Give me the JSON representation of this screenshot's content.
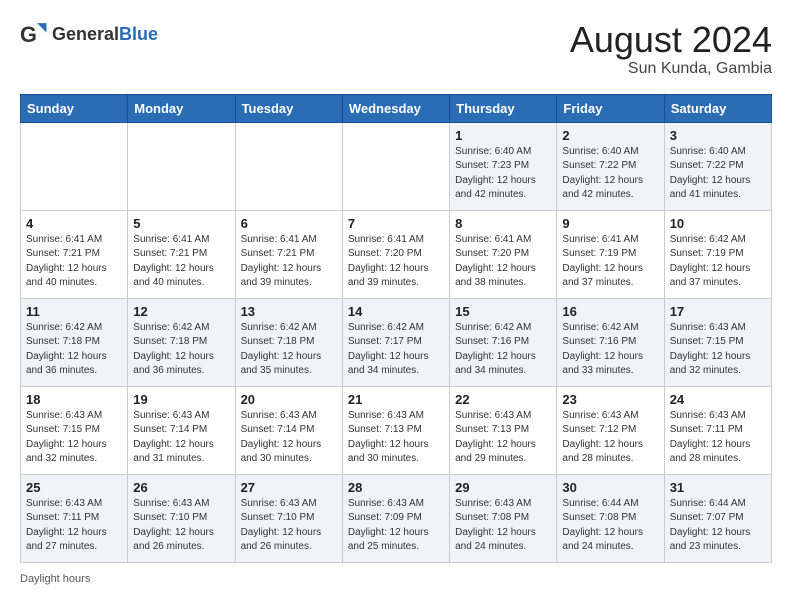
{
  "header": {
    "logo_general": "General",
    "logo_blue": "Blue",
    "month_year": "August 2024",
    "location": "Sun Kunda, Gambia"
  },
  "footer": {
    "daylight_label": "Daylight hours"
  },
  "weekdays": [
    "Sunday",
    "Monday",
    "Tuesday",
    "Wednesday",
    "Thursday",
    "Friday",
    "Saturday"
  ],
  "weeks": [
    [
      {
        "day": "",
        "info": ""
      },
      {
        "day": "",
        "info": ""
      },
      {
        "day": "",
        "info": ""
      },
      {
        "day": "",
        "info": ""
      },
      {
        "day": "1",
        "info": "Sunrise: 6:40 AM\nSunset: 7:23 PM\nDaylight: 12 hours\nand 42 minutes."
      },
      {
        "day": "2",
        "info": "Sunrise: 6:40 AM\nSunset: 7:22 PM\nDaylight: 12 hours\nand 42 minutes."
      },
      {
        "day": "3",
        "info": "Sunrise: 6:40 AM\nSunset: 7:22 PM\nDaylight: 12 hours\nand 41 minutes."
      }
    ],
    [
      {
        "day": "4",
        "info": "Sunrise: 6:41 AM\nSunset: 7:21 PM\nDaylight: 12 hours\nand 40 minutes."
      },
      {
        "day": "5",
        "info": "Sunrise: 6:41 AM\nSunset: 7:21 PM\nDaylight: 12 hours\nand 40 minutes."
      },
      {
        "day": "6",
        "info": "Sunrise: 6:41 AM\nSunset: 7:21 PM\nDaylight: 12 hours\nand 39 minutes."
      },
      {
        "day": "7",
        "info": "Sunrise: 6:41 AM\nSunset: 7:20 PM\nDaylight: 12 hours\nand 39 minutes."
      },
      {
        "day": "8",
        "info": "Sunrise: 6:41 AM\nSunset: 7:20 PM\nDaylight: 12 hours\nand 38 minutes."
      },
      {
        "day": "9",
        "info": "Sunrise: 6:41 AM\nSunset: 7:19 PM\nDaylight: 12 hours\nand 37 minutes."
      },
      {
        "day": "10",
        "info": "Sunrise: 6:42 AM\nSunset: 7:19 PM\nDaylight: 12 hours\nand 37 minutes."
      }
    ],
    [
      {
        "day": "11",
        "info": "Sunrise: 6:42 AM\nSunset: 7:18 PM\nDaylight: 12 hours\nand 36 minutes."
      },
      {
        "day": "12",
        "info": "Sunrise: 6:42 AM\nSunset: 7:18 PM\nDaylight: 12 hours\nand 36 minutes."
      },
      {
        "day": "13",
        "info": "Sunrise: 6:42 AM\nSunset: 7:18 PM\nDaylight: 12 hours\nand 35 minutes."
      },
      {
        "day": "14",
        "info": "Sunrise: 6:42 AM\nSunset: 7:17 PM\nDaylight: 12 hours\nand 34 minutes."
      },
      {
        "day": "15",
        "info": "Sunrise: 6:42 AM\nSunset: 7:16 PM\nDaylight: 12 hours\nand 34 minutes."
      },
      {
        "day": "16",
        "info": "Sunrise: 6:42 AM\nSunset: 7:16 PM\nDaylight: 12 hours\nand 33 minutes."
      },
      {
        "day": "17",
        "info": "Sunrise: 6:43 AM\nSunset: 7:15 PM\nDaylight: 12 hours\nand 32 minutes."
      }
    ],
    [
      {
        "day": "18",
        "info": "Sunrise: 6:43 AM\nSunset: 7:15 PM\nDaylight: 12 hours\nand 32 minutes."
      },
      {
        "day": "19",
        "info": "Sunrise: 6:43 AM\nSunset: 7:14 PM\nDaylight: 12 hours\nand 31 minutes."
      },
      {
        "day": "20",
        "info": "Sunrise: 6:43 AM\nSunset: 7:14 PM\nDaylight: 12 hours\nand 30 minutes."
      },
      {
        "day": "21",
        "info": "Sunrise: 6:43 AM\nSunset: 7:13 PM\nDaylight: 12 hours\nand 30 minutes."
      },
      {
        "day": "22",
        "info": "Sunrise: 6:43 AM\nSunset: 7:13 PM\nDaylight: 12 hours\nand 29 minutes."
      },
      {
        "day": "23",
        "info": "Sunrise: 6:43 AM\nSunset: 7:12 PM\nDaylight: 12 hours\nand 28 minutes."
      },
      {
        "day": "24",
        "info": "Sunrise: 6:43 AM\nSunset: 7:11 PM\nDaylight: 12 hours\nand 28 minutes."
      }
    ],
    [
      {
        "day": "25",
        "info": "Sunrise: 6:43 AM\nSunset: 7:11 PM\nDaylight: 12 hours\nand 27 minutes."
      },
      {
        "day": "26",
        "info": "Sunrise: 6:43 AM\nSunset: 7:10 PM\nDaylight: 12 hours\nand 26 minutes."
      },
      {
        "day": "27",
        "info": "Sunrise: 6:43 AM\nSunset: 7:10 PM\nDaylight: 12 hours\nand 26 minutes."
      },
      {
        "day": "28",
        "info": "Sunrise: 6:43 AM\nSunset: 7:09 PM\nDaylight: 12 hours\nand 25 minutes."
      },
      {
        "day": "29",
        "info": "Sunrise: 6:43 AM\nSunset: 7:08 PM\nDaylight: 12 hours\nand 24 minutes."
      },
      {
        "day": "30",
        "info": "Sunrise: 6:44 AM\nSunset: 7:08 PM\nDaylight: 12 hours\nand 24 minutes."
      },
      {
        "day": "31",
        "info": "Sunrise: 6:44 AM\nSunset: 7:07 PM\nDaylight: 12 hours\nand 23 minutes."
      }
    ]
  ]
}
